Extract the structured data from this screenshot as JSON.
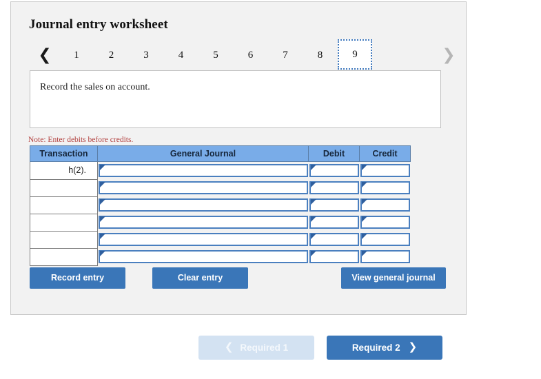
{
  "worksheet": {
    "title": "Journal entry worksheet",
    "pager": {
      "prev_icon": "chevron-left-icon",
      "next_icon": "chevron-right-icon",
      "pages": [
        "1",
        "2",
        "3",
        "4",
        "5",
        "6",
        "7",
        "8",
        "9"
      ],
      "active_page": "9"
    },
    "instruction": "Record the sales on account.",
    "note": "Note: Enter debits before credits.",
    "table": {
      "headers": {
        "transaction": "Transaction",
        "general_journal": "General Journal",
        "debit": "Debit",
        "credit": "Credit"
      },
      "rows": [
        {
          "transaction": "h(2).",
          "general_journal": "",
          "debit": "",
          "credit": ""
        },
        {
          "transaction": "",
          "general_journal": "",
          "debit": "",
          "credit": ""
        },
        {
          "transaction": "",
          "general_journal": "",
          "debit": "",
          "credit": ""
        },
        {
          "transaction": "",
          "general_journal": "",
          "debit": "",
          "credit": ""
        },
        {
          "transaction": "",
          "general_journal": "",
          "debit": "",
          "credit": ""
        },
        {
          "transaction": "",
          "general_journal": "",
          "debit": "",
          "credit": ""
        }
      ]
    },
    "actions": {
      "record_entry": "Record entry",
      "clear_entry": "Clear entry",
      "view_general_journal": "View general journal"
    }
  },
  "required_nav": {
    "prev_label": "Required 1",
    "prev_icon": "chevron-left-icon",
    "prev_disabled": true,
    "next_label": "Required 2",
    "next_icon": "chevron-right-icon"
  },
  "colors": {
    "panel_background": "#f2f2f2",
    "table_header_blue": "#79ace8",
    "button_blue": "#3a76b8",
    "disabled_button_blue": "#d3e2f2",
    "field_border_blue": "#4a7fbf",
    "note_red": "#b2413f",
    "active_tab_border": "#3d77bd"
  }
}
